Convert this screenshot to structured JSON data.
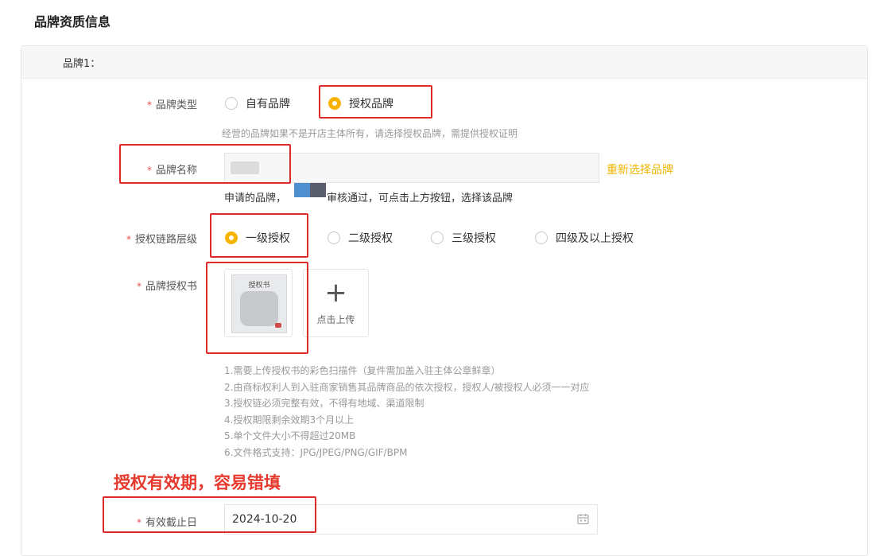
{
  "section_title": "品牌资质信息",
  "card": {
    "title": "品牌1："
  },
  "form": {
    "brand_type": {
      "label": "品牌类型",
      "options": [
        {
          "label": "自有品牌",
          "selected": false
        },
        {
          "label": "授权品牌",
          "selected": true
        }
      ],
      "hint": "经营的品牌如果不是开店主体所有，请选择授权品牌，需提供授权证明"
    },
    "brand_name": {
      "label": "品牌名称",
      "value": "",
      "reselect_link": "重新选择品牌",
      "hint_start": "申请的品牌，",
      "hint_end": "审核通过，可点击上方按钮，选择该品牌"
    },
    "auth_chain": {
      "label": "授权链路层级",
      "options": [
        {
          "label": "一级授权",
          "selected": true
        },
        {
          "label": "二级授权",
          "selected": false
        },
        {
          "label": "三级授权",
          "selected": false
        },
        {
          "label": "四级及以上授权",
          "selected": false
        }
      ]
    },
    "auth_letter": {
      "label": "品牌授权书",
      "thumb_title": "授权书",
      "upload_label": "点击上传",
      "notes": [
        "1.需要上传授权书的彩色扫描件（复件需加盖入驻主体公章鲜章）",
        "2.由商标权利人到入驻商家销售其品牌商品的依次授权，授权人/被授权人必须一一对应",
        "3.授权链必须完整有效，不得有地域、渠道限制",
        "4.授权期限剩余效期3个月以上",
        "5.单个文件大小不得超过20MB",
        "6.文件格式支持：JPG/JPEG/PNG/GIF/BPM"
      ]
    },
    "expiry": {
      "label": "有效截止日",
      "value": "2024-10-20"
    }
  },
  "annotation": "授权有效期，容易错填",
  "required_mark": "*",
  "colors": {
    "accent": "#f6b300",
    "annotation_red": "#e02a2a"
  }
}
